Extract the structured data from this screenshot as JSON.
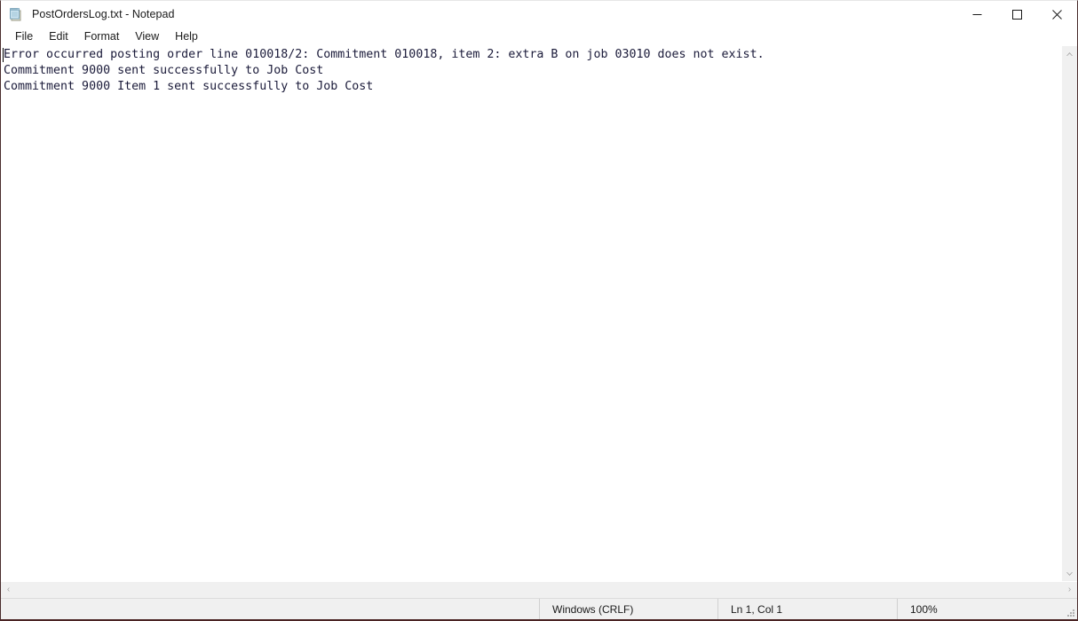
{
  "window": {
    "title": "PostOrdersLog.txt - Notepad",
    "icon": "notepad-icon",
    "controls": {
      "minimize_label": "Minimize",
      "maximize_label": "Maximize",
      "close_label": "Close"
    }
  },
  "menubar": {
    "items": [
      {
        "label": "File"
      },
      {
        "label": "Edit"
      },
      {
        "label": "Format"
      },
      {
        "label": "View"
      },
      {
        "label": "Help"
      }
    ]
  },
  "editor": {
    "content": "Error occurred posting order line 010018/2: Commitment 010018, item 2: extra B on job 03010 does not exist.\nCommitment 9000 sent successfully to Job Cost\nCommitment 9000 Item 1 sent successfully to Job Cost",
    "lines": [
      "Error occurred posting order line 010018/2: Commitment 010018, item 2: extra B on job 03010 does not exist.",
      "Commitment 9000 sent successfully to Job Cost",
      "Commitment 9000 Item 1 sent successfully to Job Cost"
    ],
    "text_color": "#1b1b3a",
    "background": "#ffffff"
  },
  "scrollbars": {
    "vertical": {
      "up_arrow": "▲",
      "down_arrow": "▼"
    },
    "horizontal": {
      "left_arrow": "‹",
      "right_arrow": "›"
    }
  },
  "statusbar": {
    "encoding": "Windows (CRLF)",
    "position": "Ln 1, Col 1",
    "zoom": "100%"
  }
}
